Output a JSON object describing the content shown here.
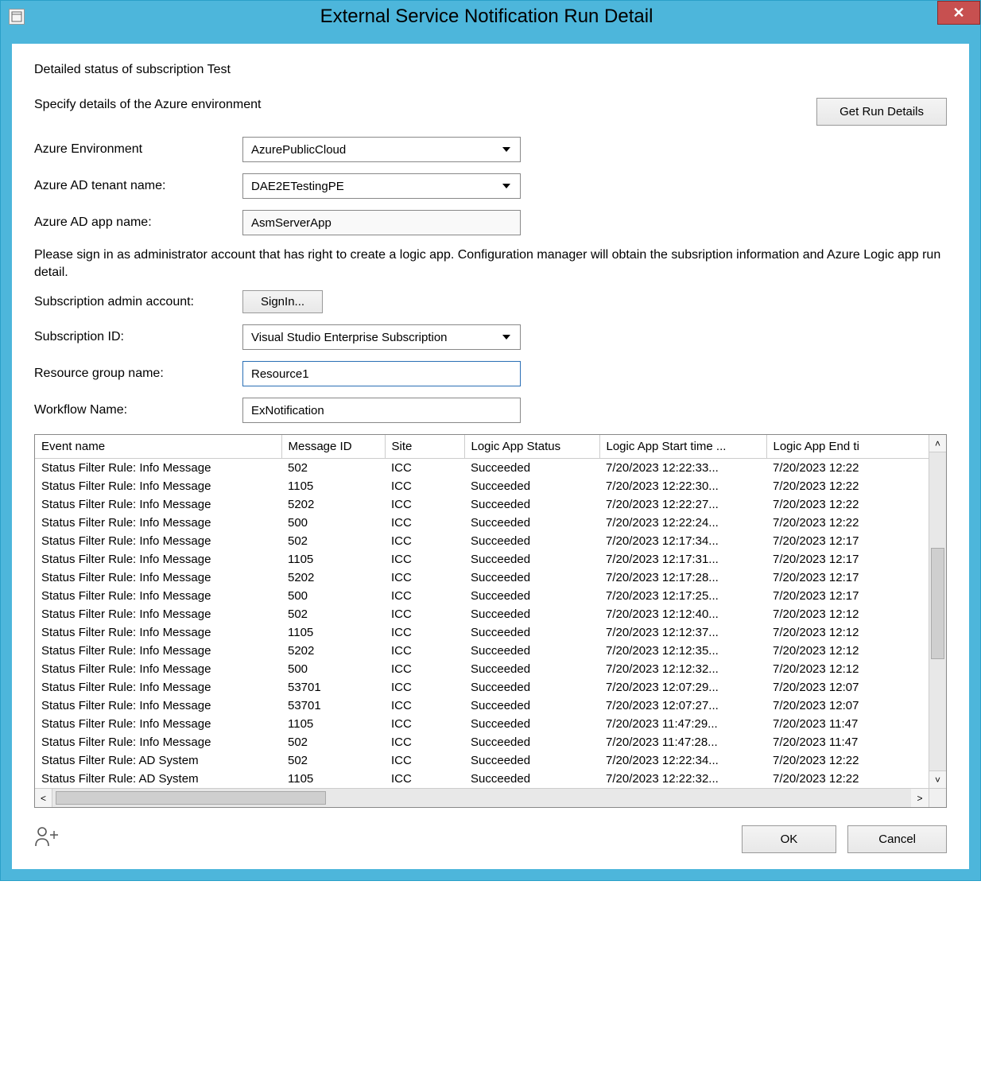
{
  "window": {
    "title": "External Service Notification Run Detail",
    "close_label": "✕"
  },
  "subtitle": "Detailed status of subscription Test",
  "specify_label": "Specify details of the Azure environment",
  "get_run_details_label": "Get Run Details",
  "fields": {
    "azure_env_label": "Azure Environment",
    "azure_env_value": "AzurePublicCloud",
    "tenant_label": "Azure AD tenant name:",
    "tenant_value": "DAE2ETestingPE",
    "app_label": "Azure AD app name:",
    "app_value": "AsmServerApp",
    "signin_text": "Please sign in as administrator account that has right to create a logic app. Configuration manager will obtain the subsription information and Azure Logic app run detail.",
    "admin_label": "Subscription admin account:",
    "signin_button": "SignIn...",
    "sub_id_label": "Subscription ID:",
    "sub_id_value": "Visual Studio Enterprise Subscription",
    "rg_label": "Resource group name:",
    "rg_value": "Resource1",
    "wf_label": "Workflow Name:",
    "wf_value": "ExNotification"
  },
  "table": {
    "headers": {
      "event": "Event name",
      "message_id": "Message ID",
      "site": "Site",
      "status": "Logic App Status",
      "start": "Logic App Start time ...",
      "end": "Logic App End ti"
    },
    "rows": [
      {
        "event": "Status Filter Rule: Info Message",
        "mid": "502",
        "site": "ICC",
        "status": "Succeeded",
        "start": "7/20/2023 12:22:33...",
        "end": "7/20/2023 12:22"
      },
      {
        "event": "Status Filter Rule: Info Message",
        "mid": "1105",
        "site": "ICC",
        "status": "Succeeded",
        "start": "7/20/2023 12:22:30...",
        "end": "7/20/2023 12:22"
      },
      {
        "event": "Status Filter Rule: Info Message",
        "mid": "5202",
        "site": "ICC",
        "status": "Succeeded",
        "start": "7/20/2023 12:22:27...",
        "end": "7/20/2023 12:22"
      },
      {
        "event": "Status Filter Rule: Info Message",
        "mid": "500",
        "site": "ICC",
        "status": "Succeeded",
        "start": "7/20/2023 12:22:24...",
        "end": "7/20/2023 12:22"
      },
      {
        "event": "Status Filter Rule: Info Message",
        "mid": "502",
        "site": "ICC",
        "status": "Succeeded",
        "start": "7/20/2023 12:17:34...",
        "end": "7/20/2023 12:17"
      },
      {
        "event": "Status Filter Rule: Info Message",
        "mid": "1105",
        "site": "ICC",
        "status": "Succeeded",
        "start": "7/20/2023 12:17:31...",
        "end": "7/20/2023 12:17"
      },
      {
        "event": "Status Filter Rule: Info Message",
        "mid": "5202",
        "site": "ICC",
        "status": "Succeeded",
        "start": "7/20/2023 12:17:28...",
        "end": "7/20/2023 12:17"
      },
      {
        "event": "Status Filter Rule: Info Message",
        "mid": "500",
        "site": "ICC",
        "status": "Succeeded",
        "start": "7/20/2023 12:17:25...",
        "end": "7/20/2023 12:17"
      },
      {
        "event": "Status Filter Rule: Info Message",
        "mid": "502",
        "site": "ICC",
        "status": "Succeeded",
        "start": "7/20/2023 12:12:40...",
        "end": "7/20/2023 12:12"
      },
      {
        "event": "Status Filter Rule: Info Message",
        "mid": "1105",
        "site": "ICC",
        "status": "Succeeded",
        "start": "7/20/2023 12:12:37...",
        "end": "7/20/2023 12:12"
      },
      {
        "event": "Status Filter Rule: Info Message",
        "mid": "5202",
        "site": "ICC",
        "status": "Succeeded",
        "start": "7/20/2023 12:12:35...",
        "end": "7/20/2023 12:12"
      },
      {
        "event": "Status Filter Rule: Info Message",
        "mid": "500",
        "site": "ICC",
        "status": "Succeeded",
        "start": "7/20/2023 12:12:32...",
        "end": "7/20/2023 12:12"
      },
      {
        "event": "Status Filter Rule: Info Message",
        "mid": "53701",
        "site": "ICC",
        "status": "Succeeded",
        "start": "7/20/2023 12:07:29...",
        "end": "7/20/2023 12:07"
      },
      {
        "event": "Status Filter Rule: Info Message",
        "mid": "53701",
        "site": "ICC",
        "status": "Succeeded",
        "start": "7/20/2023 12:07:27...",
        "end": "7/20/2023 12:07"
      },
      {
        "event": "Status Filter Rule: Info Message",
        "mid": "1105",
        "site": "ICC",
        "status": "Succeeded",
        "start": "7/20/2023 11:47:29...",
        "end": "7/20/2023 11:47"
      },
      {
        "event": "Status Filter Rule: Info Message",
        "mid": "502",
        "site": "ICC",
        "status": "Succeeded",
        "start": "7/20/2023 11:47:28...",
        "end": "7/20/2023 11:47"
      },
      {
        "event": "Status Filter Rule: AD System",
        "mid": "502",
        "site": "ICC",
        "status": "Succeeded",
        "start": "7/20/2023 12:22:34...",
        "end": "7/20/2023 12:22"
      },
      {
        "event": "Status Filter Rule: AD System",
        "mid": "1105",
        "site": "ICC",
        "status": "Succeeded",
        "start": "7/20/2023 12:22:32...",
        "end": "7/20/2023 12:22"
      }
    ]
  },
  "footer": {
    "ok": "OK",
    "cancel": "Cancel"
  }
}
